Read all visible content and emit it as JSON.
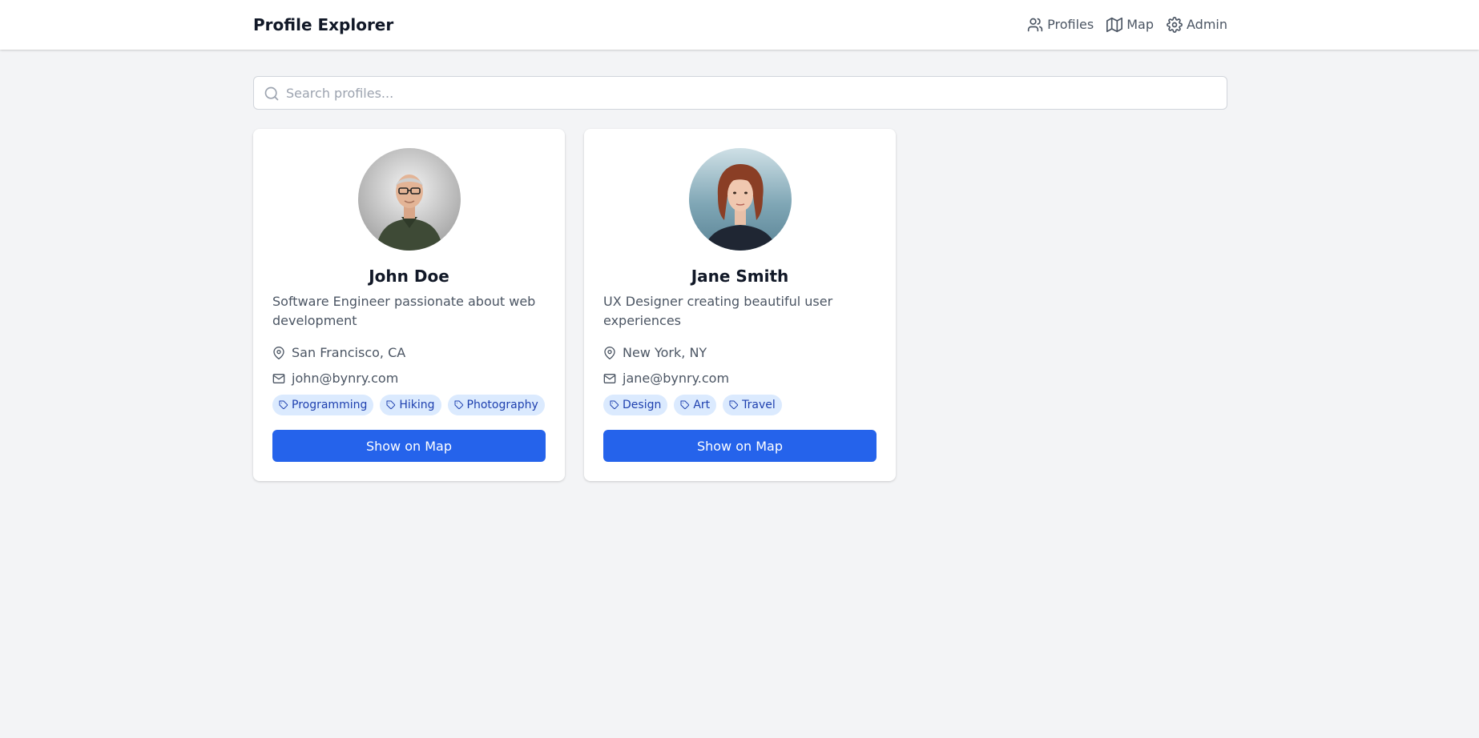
{
  "app": {
    "title": "Profile Explorer"
  },
  "nav": {
    "items": [
      {
        "label": "Profiles",
        "icon": "users-icon"
      },
      {
        "label": "Map",
        "icon": "map-icon"
      },
      {
        "label": "Admin",
        "icon": "gear-icon"
      }
    ]
  },
  "search": {
    "placeholder": "Search profiles...",
    "value": ""
  },
  "colors": {
    "primary": "#2563eb",
    "tag_bg": "#dbeafe",
    "tag_text": "#1e40af",
    "background": "#f3f4f6"
  },
  "profiles": [
    {
      "name": "John Doe",
      "bio": "Software Engineer passionate about web development",
      "location": "San Francisco, CA",
      "email": "john@bynry.com",
      "tags": [
        "Programming",
        "Hiking",
        "Photography"
      ],
      "button_label": "Show on Map"
    },
    {
      "name": "Jane Smith",
      "bio": "UX Designer creating beautiful user experiences",
      "location": "New York, NY",
      "email": "jane@bynry.com",
      "tags": [
        "Design",
        "Art",
        "Travel"
      ],
      "button_label": "Show on Map"
    }
  ]
}
